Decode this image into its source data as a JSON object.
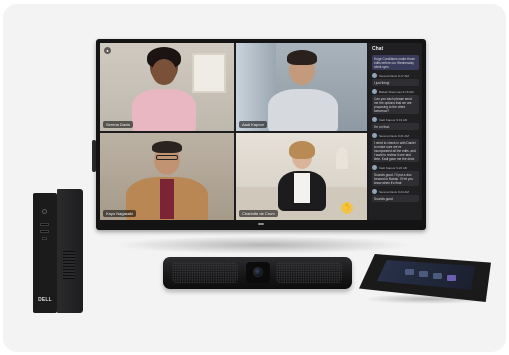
{
  "scene": {
    "description_type": "product-photo",
    "background_color": "#f3f3f3"
  },
  "monitor": {
    "screen": {
      "tiles": [
        {
          "name_tag": "Serena Davis"
        },
        {
          "name_tag": "Aadi Kapoor"
        },
        {
          "name_tag": "Kayo Nagasaki"
        },
        {
          "name_tag": "Charlotte de Crum"
        }
      ],
      "chat": {
        "title": "Chat",
        "messages": [
          {
            "author": "",
            "text": "Huge Conditions make those edits before our Wednesday client sync",
            "mine": true
          },
          {
            "author": "Serena Davis 9:17 AM",
            "text": "I just thing!",
            "mine": false
          },
          {
            "author": "Babak Shammas 9:18 AM",
            "text": "Can you each please send me the options that we are proposing to the client tomorrow?",
            "mine": false
          },
          {
            "author": "Kadi Kapoor 9:19 AM",
            "text": "I'm on that.",
            "mine": false
          },
          {
            "author": "Serena Davis 9:21 AM",
            "text": "I need to check in with Daniel to make sure we've incorporated all the edits, and I want to review it one last time. Kadi gave me the deck",
            "mine": false
          },
          {
            "author": "Kadi Kapoor 9:22 AM",
            "text": "Sounds good. I'll put a doc forward to Babak. I'll let you know when it's final",
            "mine": false
          },
          {
            "author": "Serena Davis 9:24 AM",
            "text": "Sounds good",
            "mine": false
          }
        ]
      }
    }
  },
  "pc": {
    "logo_text": "DELL"
  },
  "colors": {
    "device_black": "#1a1a1b",
    "hand_raise": "#f0c44c",
    "chat_panel": "#202022"
  }
}
